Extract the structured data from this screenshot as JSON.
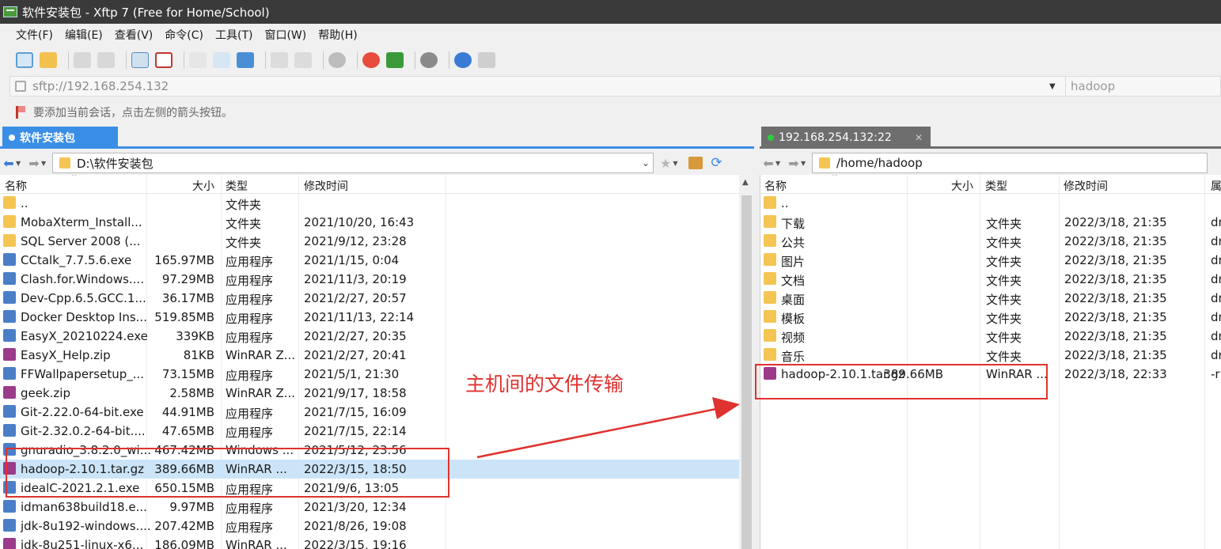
{
  "window": {
    "title": "软件安装包 - Xftp 7 (Free for Home/School)"
  },
  "menu": [
    "文件(F)",
    "编辑(E)",
    "查看(V)",
    "命令(C)",
    "工具(T)",
    "窗口(W)",
    "帮助(H)"
  ],
  "address": {
    "value": "sftp://192.168.254.132",
    "user_placeholder": "hadoop"
  },
  "hint": "要添加当前会话，点击左侧的箭头按钮。",
  "left": {
    "tab": "软件安装包",
    "path": "D:\\软件安装包",
    "columns": {
      "name": "名称",
      "size": "大小",
      "type": "类型",
      "mtime": "修改时间"
    },
    "rows": [
      {
        "name": "..",
        "size": "",
        "type": "文件夹",
        "mtime": "",
        "icon": "folder-icon"
      },
      {
        "name": "MobaXterm_Install...",
        "size": "",
        "type": "文件夹",
        "mtime": "2021/10/20, 16:43",
        "icon": "folder-icon"
      },
      {
        "name": "SQL Server 2008  (...",
        "size": "",
        "type": "文件夹",
        "mtime": "2021/9/12, 23:28",
        "icon": "folder-icon"
      },
      {
        "name": "CCtalk_7.7.5.6.exe",
        "size": "165.97MB",
        "type": "应用程序",
        "mtime": "2021/1/15, 0:04",
        "icon": "app-icon"
      },
      {
        "name": "Clash.for.Windows....",
        "size": "97.29MB",
        "type": "应用程序",
        "mtime": "2021/11/3, 20:19",
        "icon": "app-icon"
      },
      {
        "name": "Dev-Cpp.6.5.GCC.1...",
        "size": "36.17MB",
        "type": "应用程序",
        "mtime": "2021/2/27, 20:57",
        "icon": "app-icon"
      },
      {
        "name": "Docker Desktop Ins...",
        "size": "519.85MB",
        "type": "应用程序",
        "mtime": "2021/11/13, 22:14",
        "icon": "app-icon"
      },
      {
        "name": "EasyX_20210224.exe",
        "size": "339KB",
        "type": "应用程序",
        "mtime": "2021/2/27, 20:35",
        "icon": "app-icon"
      },
      {
        "name": "EasyX_Help.zip",
        "size": "81KB",
        "type": "WinRAR Z...",
        "mtime": "2021/2/27, 20:41",
        "icon": "archive-icon"
      },
      {
        "name": "FFWallpapersetup_...",
        "size": "73.15MB",
        "type": "应用程序",
        "mtime": "2021/5/1, 21:30",
        "icon": "app-icon"
      },
      {
        "name": "geek.zip",
        "size": "2.58MB",
        "type": "WinRAR Z...",
        "mtime": "2021/9/17, 18:58",
        "icon": "archive-icon"
      },
      {
        "name": "Git-2.22.0-64-bit.exe",
        "size": "44.91MB",
        "type": "应用程序",
        "mtime": "2021/7/15, 16:09",
        "icon": "app-icon"
      },
      {
        "name": "Git-2.32.0.2-64-bit....",
        "size": "47.65MB",
        "type": "应用程序",
        "mtime": "2021/7/15, 22:14",
        "icon": "app-icon"
      },
      {
        "name": "gnuradio_3.8.2.0_wi...",
        "size": "467.42MB",
        "type": "Windows ...",
        "mtime": "2021/5/12, 23:56",
        "icon": "app-icon"
      },
      {
        "name": "hadoop-2.10.1.tar.gz",
        "size": "389.66MB",
        "type": "WinRAR ...",
        "mtime": "2022/3/15, 18:50",
        "icon": "archive-icon",
        "selected": true
      },
      {
        "name": "idealC-2021.2.1.exe",
        "size": "650.15MB",
        "type": "应用程序",
        "mtime": "2021/9/6, 13:05",
        "icon": "app-icon"
      },
      {
        "name": "idman638build18.e...",
        "size": "9.97MB",
        "type": "应用程序",
        "mtime": "2021/3/20, 12:34",
        "icon": "app-icon"
      },
      {
        "name": "jdk-8u192-windows....",
        "size": "207.42MB",
        "type": "应用程序",
        "mtime": "2021/8/26, 19:08",
        "icon": "app-icon"
      },
      {
        "name": "jdk-8u251-linux-x6...",
        "size": "186.09MB",
        "type": "WinRAR ...",
        "mtime": "2022/3/15, 19:16",
        "icon": "archive-icon"
      }
    ]
  },
  "right": {
    "tab": "192.168.254.132:22",
    "path": "/home/hadoop",
    "columns": {
      "name": "名称",
      "size": "大小",
      "type": "类型",
      "mtime": "修改时间",
      "attr": "属"
    },
    "rows": [
      {
        "name": "..",
        "size": "",
        "type": "",
        "mtime": "",
        "attr": "",
        "icon": "folder-icon"
      },
      {
        "name": "下载",
        "size": "",
        "type": "文件夹",
        "mtime": "2022/3/18, 21:35",
        "attr": "dr",
        "icon": "folder-icon"
      },
      {
        "name": "公共",
        "size": "",
        "type": "文件夹",
        "mtime": "2022/3/18, 21:35",
        "attr": "dr",
        "icon": "folder-icon"
      },
      {
        "name": "图片",
        "size": "",
        "type": "文件夹",
        "mtime": "2022/3/18, 21:35",
        "attr": "dr",
        "icon": "folder-icon"
      },
      {
        "name": "文档",
        "size": "",
        "type": "文件夹",
        "mtime": "2022/3/18, 21:35",
        "attr": "dr",
        "icon": "folder-icon"
      },
      {
        "name": "桌面",
        "size": "",
        "type": "文件夹",
        "mtime": "2022/3/18, 21:35",
        "attr": "dr",
        "icon": "folder-icon"
      },
      {
        "name": "模板",
        "size": "",
        "type": "文件夹",
        "mtime": "2022/3/18, 21:35",
        "attr": "dr",
        "icon": "folder-icon"
      },
      {
        "name": "视频",
        "size": "",
        "type": "文件夹",
        "mtime": "2022/3/18, 21:35",
        "attr": "dr",
        "icon": "folder-icon"
      },
      {
        "name": "音乐",
        "size": "",
        "type": "文件夹",
        "mtime": "2022/3/18, 21:35",
        "attr": "dr",
        "icon": "folder-icon"
      },
      {
        "name": "hadoop-2.10.1.tar.gz",
        "size": "389.66MB",
        "type": "WinRAR ...",
        "mtime": "2022/3/18, 22:33",
        "attr": "-r",
        "icon": "archive-icon"
      }
    ]
  },
  "annotation": "主机间的文件传输",
  "colors": {
    "accent": "#3a8ee6",
    "annotation": "#e0322f",
    "selection": "#cce4f7",
    "titlebar": "#3a3a3a"
  }
}
